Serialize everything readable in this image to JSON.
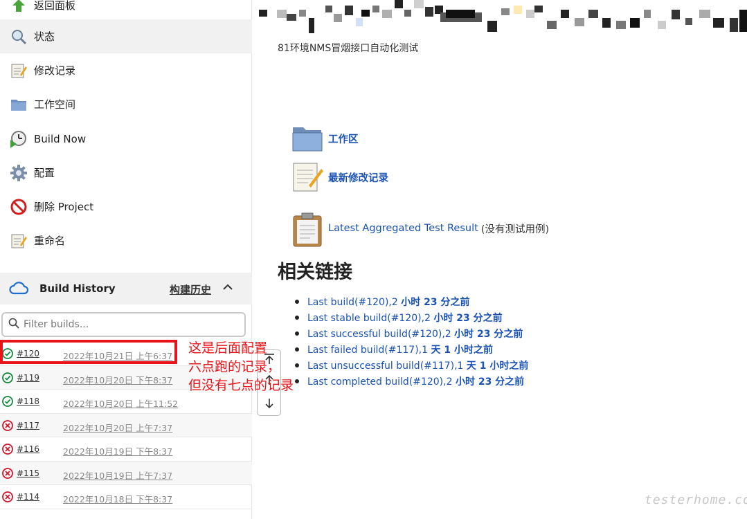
{
  "sidebar": {
    "tasks": [
      {
        "label": "返回面板",
        "icon": "up-arrow-icon"
      },
      {
        "label": "状态",
        "icon": "search-icon"
      },
      {
        "label": "修改记录",
        "icon": "notepad-icon"
      },
      {
        "label": "工作空间",
        "icon": "folder-icon"
      },
      {
        "label": "Build Now",
        "icon": "clock-play-icon"
      },
      {
        "label": "配置",
        "icon": "gear-icon"
      },
      {
        "label": "删除 Project",
        "icon": "no-entry-icon"
      },
      {
        "label": "重命名",
        "icon": "notepad-icon"
      }
    ]
  },
  "build_history": {
    "title": "Build History",
    "trend_link": "构建历史",
    "filter_placeholder": "Filter builds...",
    "builds": [
      {
        "number": "#120",
        "date": "2022年10月21日 上午6:37",
        "status": "success"
      },
      {
        "number": "#119",
        "date": "2022年10月20日 下午8:37",
        "status": "success"
      },
      {
        "number": "#118",
        "date": "2022年10月20日 上午11:52",
        "status": "success"
      },
      {
        "number": "#117",
        "date": "2022年10月20日 上午7:37",
        "status": "failed"
      },
      {
        "number": "#116",
        "date": "2022年10月19日 下午8:37",
        "status": "failed"
      },
      {
        "number": "#115",
        "date": "2022年10月19日 上午7:37",
        "status": "failed"
      },
      {
        "number": "#114",
        "date": "2022年10月18日 下午8:37",
        "status": "failed"
      }
    ]
  },
  "main": {
    "description": "81环境NMS冒烟接口自动化测试",
    "links": {
      "workspace": "工作区",
      "changes": "最新修改记录",
      "test_result": "Latest Aggregated Test Result",
      "test_result_note": "(没有测试用例)"
    },
    "related_heading": "相关链接",
    "permalinks": [
      {
        "label": "Last build(#120),2 ",
        "time": "小时 23 分之前"
      },
      {
        "label": "Last stable build(#120),2 ",
        "time": "小时 23 分之前"
      },
      {
        "label": "Last successful build(#120),2 ",
        "time": "小时 23 分之前"
      },
      {
        "label": "Last failed build(#117),1 ",
        "time": "天 1 小时之前"
      },
      {
        "label": "Last unsuccessful build(#117),1 ",
        "time": "天 1 小时之前"
      },
      {
        "label": "Last completed build(#120),2 ",
        "time": "小时 23 分之前"
      }
    ]
  },
  "annotation": {
    "lines": [
      "这是后面配置",
      "六点跑的记录，",
      "但没有七点的记录"
    ]
  },
  "watermark": "testerhome.com",
  "colors": {
    "link": "#1a52b3",
    "success": "#138a3b",
    "failed": "#d0142a",
    "annotation": "#e8141a"
  }
}
